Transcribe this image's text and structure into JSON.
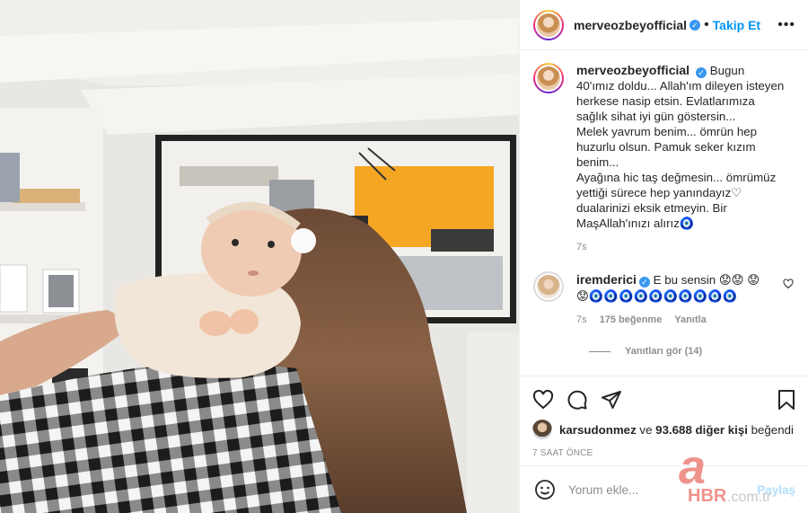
{
  "post": {
    "username": "merveozbeyofficial",
    "verified": true,
    "follow_label": "Takip Et",
    "caption": "Bugun 40'ımız doldu... Allah'ım dileyen isteyen herkese nasip etsin. Evlatlarımıza sağlık sihat iyi gün göstersin...\nMelek yavrum benim... ömrün hep huzurlu olsun. Pamuk seker kızım benim...\nAyağına hic taş değmesin... ömrümüz yettiği sürece hep yanındayız♡ dualarinizi eksik etmeyin. Bir MaşAllah'ınızı alırız🧿",
    "caption_time": "7s"
  },
  "comment": {
    "username": "iremderici",
    "verified": true,
    "text": "E bu sensin 😟😟 😟😟🧿🧿🧿🧿🧿🧿🧿🧿🧿🧿",
    "time": "7s",
    "likes": "175 beğenme",
    "reply_label": "Yanıtla",
    "view_replies": "Yanıtları gör (14)"
  },
  "likes": {
    "user": "karsudonmez",
    "joiner": "ve",
    "others": "93.688 diğer kişi",
    "suffix": "beğendi"
  },
  "posted_ago": "7 SAAT ÖNCE",
  "add_comment": {
    "placeholder": "Yorum ekle...",
    "post_label": "Paylaş"
  },
  "watermark": {
    "letter": "a",
    "brand": "HBR",
    "suffix": ".com.tr"
  },
  "icons": [
    "more-icon",
    "heart-icon",
    "comment-icon",
    "share-icon",
    "bookmark-icon",
    "emoji-icon"
  ],
  "colors": {
    "accent": "#0095f6",
    "verified": "#3897f0",
    "muted": "#8e8e8e",
    "orange": "#f5a623"
  }
}
